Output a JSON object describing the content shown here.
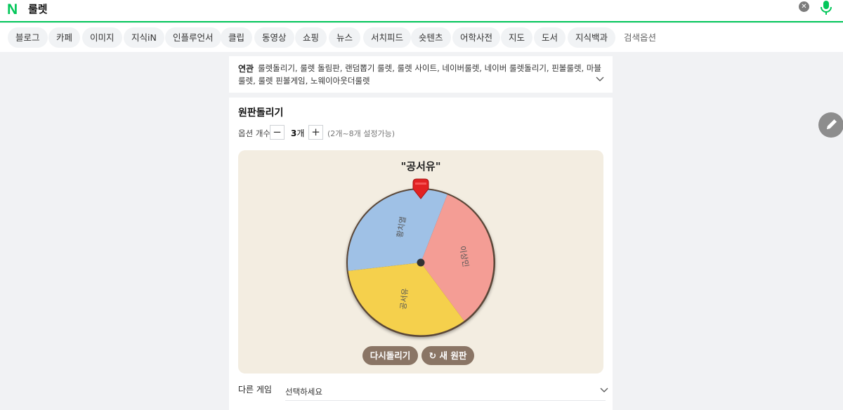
{
  "search": {
    "logo": "N",
    "query": "룰렛",
    "clear_icon": "close-icon",
    "mic_icon": "microphone-icon"
  },
  "tabs": [
    {
      "label": "블로그"
    },
    {
      "label": "카페"
    },
    {
      "label": "이미지"
    },
    {
      "label": "지식iN"
    },
    {
      "label": "인플루언서"
    },
    {
      "label": "클립"
    },
    {
      "label": "동영상"
    },
    {
      "label": "쇼핑"
    },
    {
      "label": "뉴스"
    },
    {
      "label": "서치피드"
    },
    {
      "label": "숏텐츠"
    },
    {
      "label": "어학사전"
    },
    {
      "label": "지도"
    },
    {
      "label": "도서"
    },
    {
      "label": "지식백과"
    },
    {
      "label": "검색옵션"
    }
  ],
  "related": {
    "label": "연관",
    "text": "룰렛돌리기, 룰렛 돌림판, 랜덤뽑기 룰렛, 룰렛 사이트, 네이버룰렛, 네이버 룰렛돌리기, 핀볼룰렛, 마블룰렛, 룰렛 핀볼게임, 노웨이아웃더룰렛"
  },
  "roulette": {
    "title": "원판돌리기",
    "option_label": "옵션 개수",
    "minus": "−",
    "plus": "+",
    "count_value": "3",
    "count_unit": "개",
    "hint": "(2개~8개 설정가능)",
    "result": "\"공서유\"",
    "segments": [
      {
        "label": "황치열",
        "color": "#9fc1e6"
      },
      {
        "label": "이상민",
        "color": "#f49d95"
      },
      {
        "label": "공서유",
        "color": "#f5d04c"
      }
    ],
    "spin_again": "다시돌리기",
    "new_wheel": "새 원판",
    "refresh_icon": "refresh-icon"
  },
  "other_game": {
    "label": "다른 게임",
    "value": "선택하세요"
  },
  "fab_icon": "pencil-icon"
}
